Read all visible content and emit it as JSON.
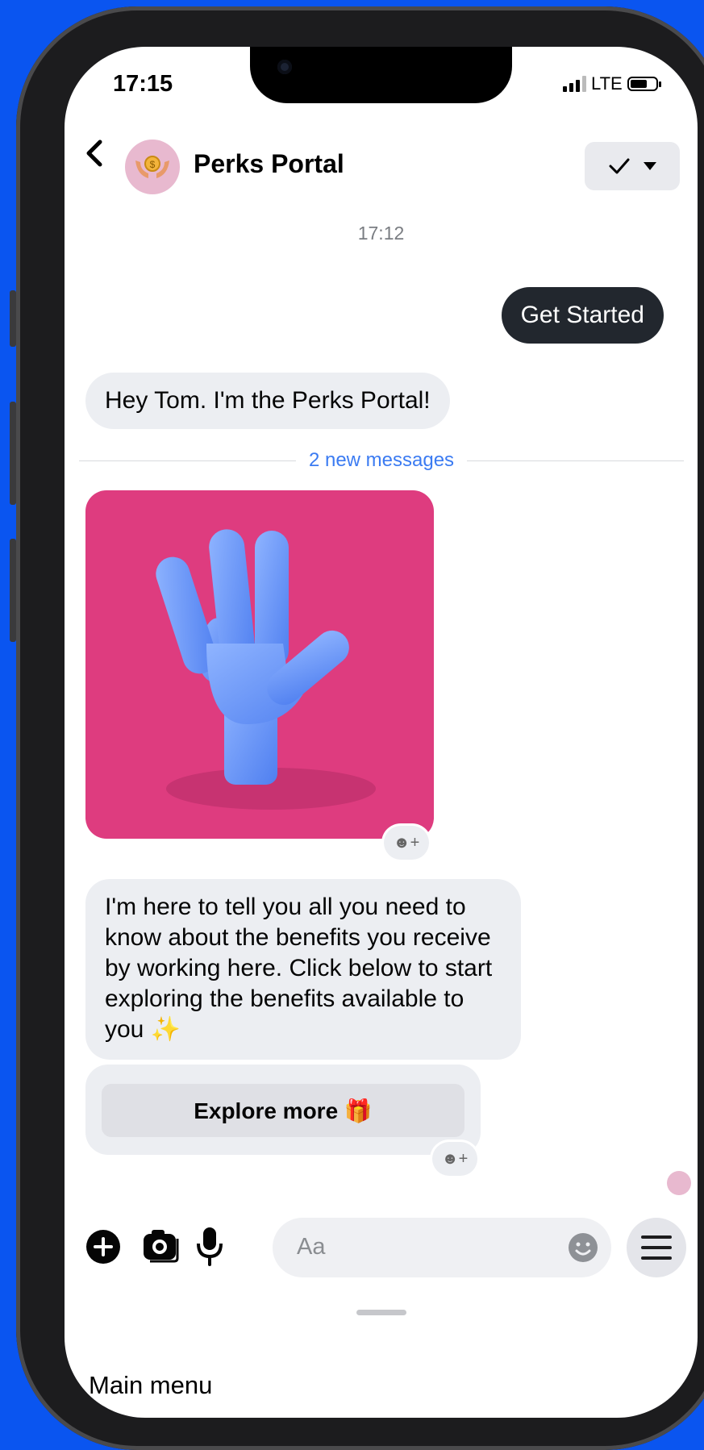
{
  "status_bar": {
    "time": "17:15",
    "network": "LTE"
  },
  "header": {
    "title": "Perks Portal",
    "back_icon": "chevron-left-icon",
    "action_icons": [
      "checkmark-icon",
      "caret-down-icon"
    ]
  },
  "conversation": {
    "timestamp": "17:12",
    "messages": [
      {
        "from": "user",
        "text": "Get Started"
      },
      {
        "from": "bot",
        "text": "Hey Tom. I'm the Perks Portal!"
      },
      {
        "type": "divider",
        "text": "2 new messages"
      },
      {
        "from": "bot",
        "type": "image",
        "description_icon": "waving-hand-image"
      },
      {
        "from": "bot",
        "text": "I'm here to tell you all you need to know about the benefits you receive by working here. Click below to start exploring the benefits available to you ✨"
      }
    ],
    "quick_reply": {
      "label": "Explore more 🎁"
    }
  },
  "composer": {
    "placeholder": "Aa",
    "icons": [
      "plus-icon",
      "camera-icon",
      "microphone-icon",
      "emoji-icon",
      "menu-icon"
    ]
  },
  "footer": {
    "main_menu_label": "Main menu"
  },
  "colors": {
    "background": "#0A55F0",
    "outgoing_bubble": "#22272e",
    "incoming_bubble": "#eceef2",
    "link_blue": "#3b7bf2",
    "image_bg": "#de3c7f"
  }
}
